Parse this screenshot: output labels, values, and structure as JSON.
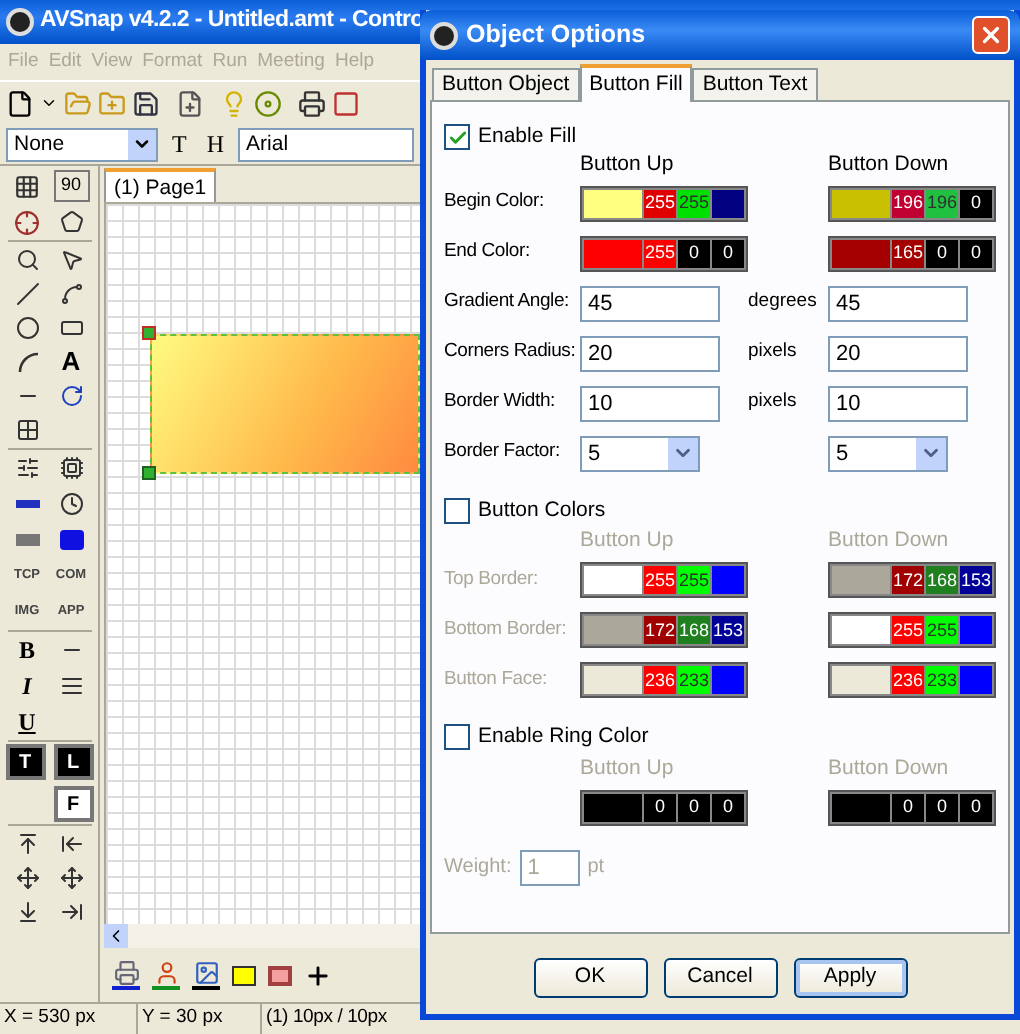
{
  "app": {
    "title": "AVSnap v4.2.2 - Untitled.amt - Contro",
    "menu": [
      "File",
      "Edit",
      "View",
      "Format",
      "Run",
      "Meeting",
      "Help"
    ],
    "style_select": "None",
    "format_buttons": [
      "T",
      "H"
    ],
    "font_field": "Arial",
    "page_tab": "(1) Page1",
    "toolbox": {
      "zoom_label": "90",
      "text_tool": "A",
      "protocol_tools": [
        "TCP",
        "COM",
        "IMG",
        "APP"
      ],
      "style_tools": [
        "B",
        "I",
        "U"
      ],
      "text_modes": [
        {
          "label": "T",
          "selected": true
        },
        {
          "label": "L",
          "selected": true
        },
        {
          "label": "F",
          "selected": false
        }
      ]
    },
    "status_bar": [
      "X = 530 px",
      "Y = 30 px",
      "(1) 10px / 10px"
    ]
  },
  "dialog": {
    "title": "Object Options",
    "tabs": [
      {
        "label": "Button Object",
        "selected": false
      },
      {
        "label": "Button Fill",
        "selected": true
      },
      {
        "label": "Button Text",
        "selected": false
      }
    ],
    "sections": [
      {
        "label": "Enable Fill",
        "checked": true,
        "columns": [
          "Button Up",
          "Button Down"
        ],
        "rows": [
          {
            "kind": "color",
            "label": "Begin Color:",
            "up": {
              "color": "#ffff80",
              "channels": [
                {
                  "text": "255",
                  "color": "#e00000"
                },
                {
                  "text": "255",
                  "color": "#00e000"
                },
                {
                  "color": "#000080"
                }
              ]
            },
            "down": {
              "color": "#c8c000",
              "channels": [
                {
                  "text": "196",
                  "color": "#c00030"
                },
                {
                  "text": "196",
                  "color": "#20c040"
                },
                {
                  "text": "0",
                  "color": "#000000"
                }
              ]
            }
          },
          {
            "kind": "color",
            "label": "End Color:",
            "up": {
              "color": "#ff0000",
              "channels": [
                {
                  "text": "255",
                  "color": "#ff0000"
                },
                {
                  "text": "0",
                  "color": "#000000"
                },
                {
                  "text": "0",
                  "color": "#000000"
                }
              ]
            },
            "down": {
              "color": "#a50000",
              "channels": [
                {
                  "text": "165",
                  "color": "#a50000"
                },
                {
                  "text": "0",
                  "color": "#000000"
                },
                {
                  "text": "0",
                  "color": "#000000"
                }
              ]
            }
          },
          {
            "kind": "input",
            "label": "Gradient Angle:",
            "up": "45",
            "unit": "degrees",
            "down": "45"
          },
          {
            "kind": "input",
            "label": "Corners Radius:",
            "up": "20",
            "unit": "pixels",
            "down": "20"
          },
          {
            "kind": "input",
            "label": "Border Width:",
            "up": "10",
            "unit": "pixels",
            "down": "10"
          },
          {
            "kind": "select",
            "label": "Border Factor:",
            "up": "5",
            "down": "5"
          }
        ]
      },
      {
        "label": "Button Colors",
        "checked": false,
        "columns": [
          "Button Up",
          "Button Down"
        ],
        "rows": [
          {
            "kind": "color",
            "label": "Top Border:",
            "up": {
              "color": "#ffffff",
              "channels": [
                {
                  "text": "255",
                  "color": "#ff0000"
                },
                {
                  "text": "255",
                  "color": "#00ff00"
                },
                {
                  "color": "#0000ff"
                }
              ]
            },
            "down": {
              "color": "#aca899",
              "channels": [
                {
                  "text": "172",
                  "color": "#a00000"
                },
                {
                  "text": "168",
                  "color": "#208020"
                },
                {
                  "text": "153",
                  "color": "#000099"
                }
              ]
            }
          },
          {
            "kind": "color",
            "label": "Bottom Border:",
            "up": {
              "color": "#aca899",
              "channels": [
                {
                  "text": "172",
                  "color": "#a00000"
                },
                {
                  "text": "168",
                  "color": "#208020"
                },
                {
                  "text": "153",
                  "color": "#000099"
                }
              ]
            },
            "down": {
              "color": "#ffffff",
              "channels": [
                {
                  "text": "255",
                  "color": "#ff0000"
                },
                {
                  "text": "255",
                  "color": "#00ff00"
                },
                {
                  "color": "#0000ff"
                }
              ]
            }
          },
          {
            "kind": "color",
            "label": "Button Face:",
            "up": {
              "color": "#ece9d8",
              "channels": [
                {
                  "text": "236",
                  "color": "#ff0000"
                },
                {
                  "text": "233",
                  "color": "#00ff00"
                },
                {
                  "color": "#0000ff"
                }
              ]
            },
            "down": {
              "color": "#ece9d8",
              "channels": [
                {
                  "text": "236",
                  "color": "#ff0000"
                },
                {
                  "text": "233",
                  "color": "#00ff00"
                },
                {
                  "color": "#0000ff"
                }
              ]
            }
          }
        ]
      },
      {
        "label": "Enable Ring Color",
        "checked": false,
        "columns": [
          "Button Up",
          "Button Down"
        ],
        "rows": [
          {
            "kind": "color",
            "up": {
              "color": "#000000",
              "channels": [
                {
                  "text": "0",
                  "color": "#000000"
                },
                {
                  "text": "0",
                  "color": "#000000"
                },
                {
                  "text": "0",
                  "color": "#000000"
                }
              ]
            },
            "down": {
              "color": "#000000",
              "channels": [
                {
                  "text": "0",
                  "color": "#000000"
                },
                {
                  "text": "0",
                  "color": "#000000"
                },
                {
                  "text": "0",
                  "color": "#000000"
                }
              ]
            }
          }
        ],
        "weight": {
          "label": "Weight:",
          "value": "1",
          "unit": "pt"
        }
      }
    ],
    "buttons": [
      {
        "label": "OK",
        "default": false
      },
      {
        "label": "Cancel",
        "default": false
      },
      {
        "label": "Apply",
        "default": true
      }
    ]
  }
}
